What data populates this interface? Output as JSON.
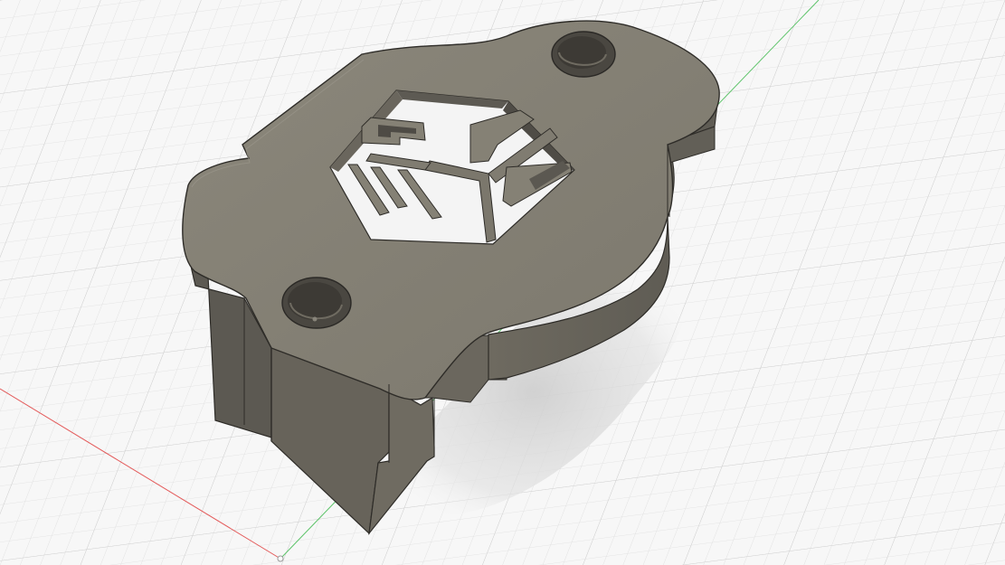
{
  "viewport": {
    "kind": "3d-cad-viewport",
    "background_color": "#f7f7f7",
    "grid_color": "#d9d9d9",
    "grid_major_color": "#c8c8c8",
    "x_axis_color": "#e45c5c",
    "y_axis_color": "#5ec46b"
  },
  "model": {
    "body_color": "#7a766d",
    "top_face_color": "#858175",
    "side_face_color": "#6b675e",
    "dark_side_color": "#55524b",
    "edge_color": "#2e2c28",
    "shadow_color": "#d2d2d2",
    "holes": 2,
    "cutout_logo": "hexagon-cube-logo"
  }
}
